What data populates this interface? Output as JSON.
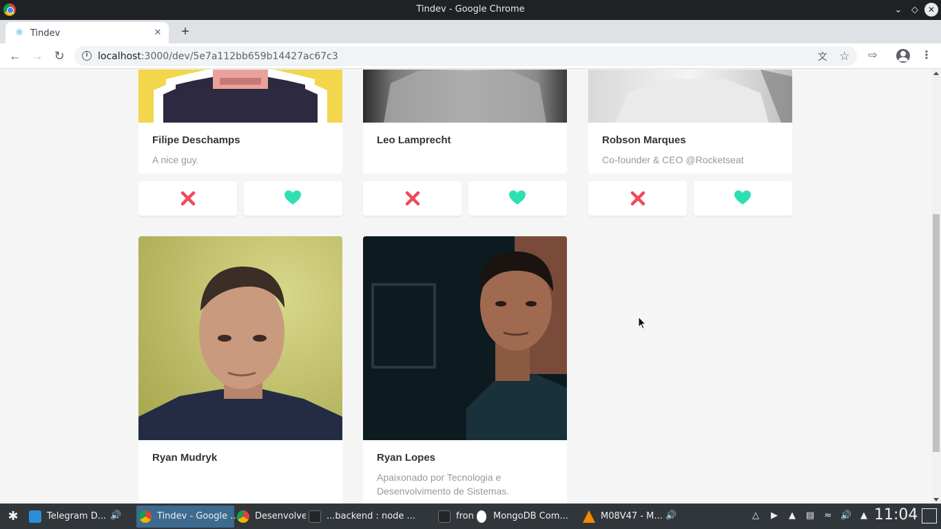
{
  "window": {
    "title": "Tindev - Google Chrome"
  },
  "tab": {
    "title": "Tindev"
  },
  "address": {
    "host": "localhost",
    "path": ":3000/dev/5e7a112bb659b14427ac67c3"
  },
  "devs": [
    {
      "name": "Filipe Deschamps",
      "bio": "A nice guy.",
      "photo": "filipe"
    },
    {
      "name": "Leo Lamprecht",
      "bio": "",
      "photo": "leo"
    },
    {
      "name": "Robson Marques",
      "bio": "Co-founder & CEO @Rocketseat",
      "photo": "robson"
    },
    {
      "name": "Ryan Mudryk",
      "bio": "",
      "photo": "mudryk"
    },
    {
      "name": "Ryan Lopes",
      "bio": "Apaixonado por Tecnologia e Desenvolvimento de Sistemas.",
      "photo": "lopes"
    }
  ],
  "colors": {
    "dislike": "#f04a5c",
    "like": "#2de0b4",
    "active_task": "#3d6a8f"
  },
  "taskbar": {
    "tasks": [
      {
        "label": "Telegram D...",
        "icon": "telegram-icon"
      },
      {
        "label": "Tindev - Google ...",
        "icon": "chrome-icon"
      },
      {
        "label": "Desenvolvedo",
        "icon": "chrome-icon"
      },
      {
        "label": "...backend : node ...",
        "icon": "terminal-icon"
      },
      {
        "label": "fron",
        "icon": "terminal-icon"
      },
      {
        "label": "MongoDB Com...",
        "icon": "mongodb-icon"
      },
      {
        "label": "M08V47 - M...",
        "icon": "vlc-icon"
      }
    ],
    "clock": "11:04"
  }
}
